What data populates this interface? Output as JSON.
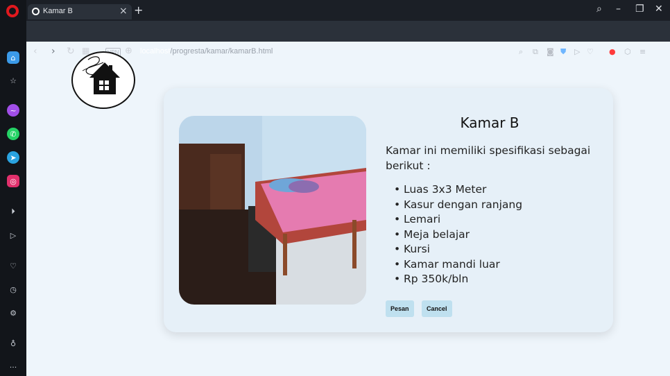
{
  "browser": {
    "tab_title": "Kamar B",
    "tab_close": "×",
    "new_tab": "+",
    "vpn_label": "VPN",
    "url_host": "localhost",
    "url_path": "/progresta/kamar/kamarB.html"
  },
  "card": {
    "title": "Kamar B",
    "description": "Kamar ini memiliki spesifikasi sebagai berikut :",
    "features": [
      "Luas 3x3 Meter",
      "Kasur dengan ranjang",
      "Lemari",
      "Meja belajar",
      "Kursi",
      "Kamar mandi luar",
      "Rp 350k/bln"
    ],
    "pesan_label": "Pesan",
    "cancel_label": "Cancel"
  },
  "icons": {
    "sidebar": [
      "home-icon",
      "star-icon",
      "messenger-icon",
      "whatsapp-icon",
      "telegram-icon",
      "instagram-icon",
      "player-icon",
      "send-icon",
      "heart-icon",
      "history-icon",
      "settings-icon",
      "bulb-icon",
      "more-icon"
    ],
    "toolbar": [
      "search-icon",
      "snapshot-icon",
      "camera-icon",
      "shield-icon",
      "play-icon",
      "heart-icon",
      "extension-adblock-icon",
      "cube-icon",
      "easy-setup-icon"
    ]
  },
  "colors": {
    "accent_sidebar_home": "#3b9ae8",
    "page_bg": "#eef5fb",
    "card_bg": "#e6f0f8",
    "button_bg": "#bfe0ef"
  }
}
